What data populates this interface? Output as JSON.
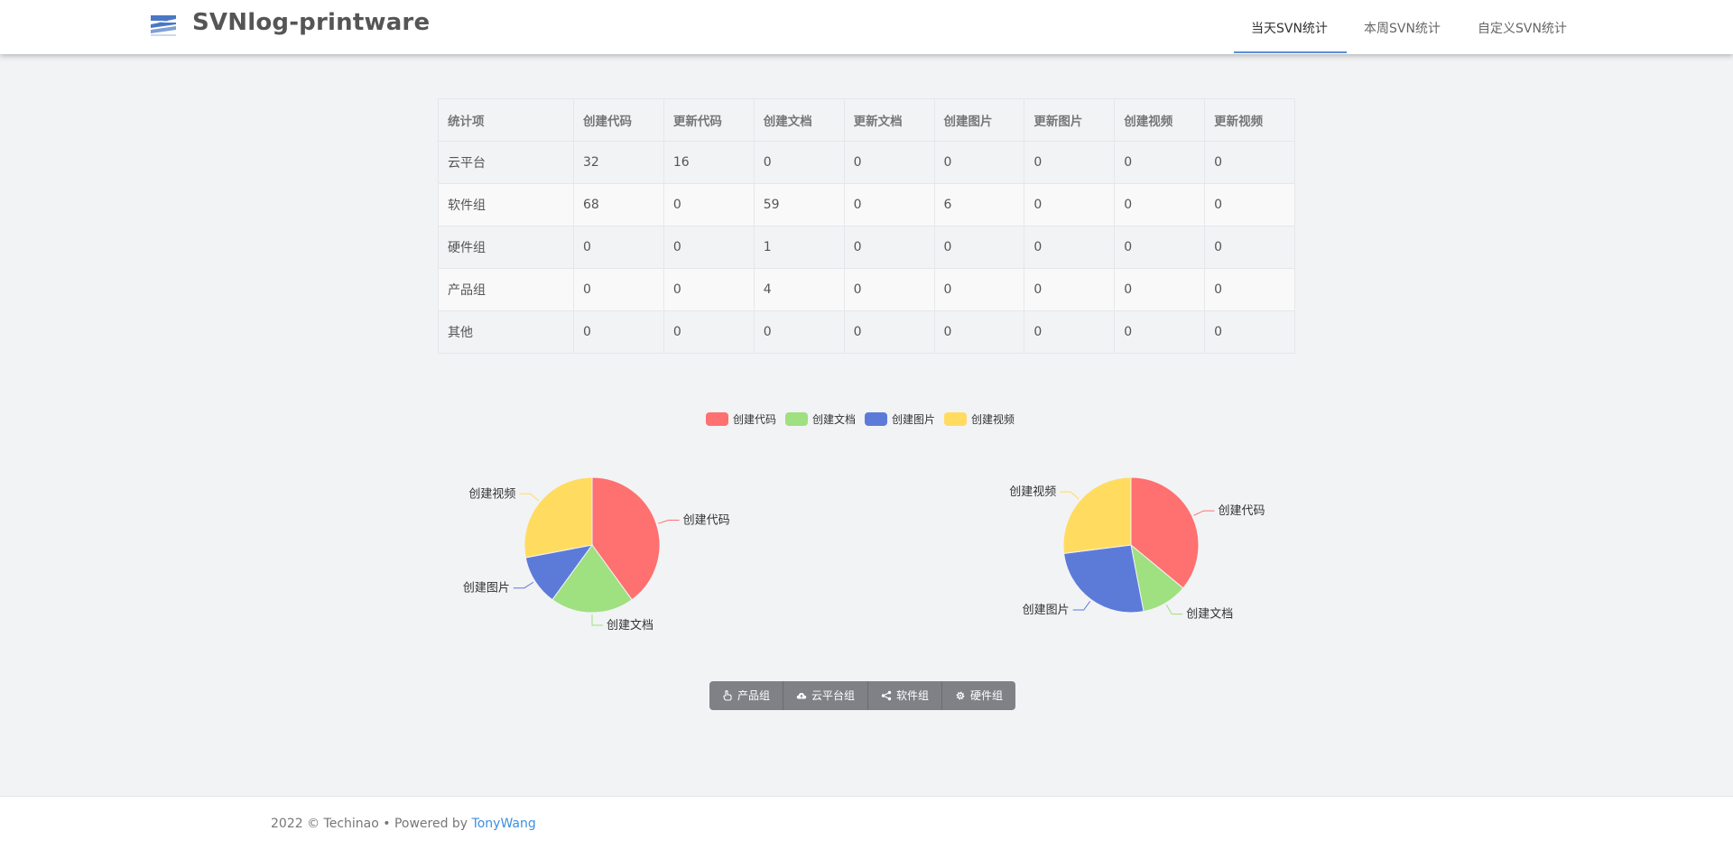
{
  "header": {
    "title": "SVNlog-printware",
    "nav": [
      {
        "label": "当天SVN统计",
        "active": true
      },
      {
        "label": "本周SVN统计",
        "active": false
      },
      {
        "label": "自定义SVN统计",
        "active": false
      }
    ]
  },
  "table": {
    "headers": [
      "统计项",
      "创建代码",
      "更新代码",
      "创建文档",
      "更新文档",
      "创建图片",
      "更新图片",
      "创建视频",
      "更新视频"
    ],
    "rows": [
      [
        "云平台",
        "32",
        "16",
        "0",
        "0",
        "0",
        "0",
        "0",
        "0"
      ],
      [
        "软件组",
        "68",
        "0",
        "59",
        "0",
        "6",
        "0",
        "0",
        "0"
      ],
      [
        "硬件组",
        "0",
        "0",
        "1",
        "0",
        "0",
        "0",
        "0",
        "0"
      ],
      [
        "产品组",
        "0",
        "0",
        "4",
        "0",
        "0",
        "0",
        "0",
        "0"
      ],
      [
        "其他",
        "0",
        "0",
        "0",
        "0",
        "0",
        "0",
        "0",
        "0"
      ]
    ]
  },
  "legend": [
    {
      "label": "创建代码",
      "color": "#ff7070"
    },
    {
      "label": "创建文档",
      "color": "#9fe080"
    },
    {
      "label": "创建图片",
      "color": "#5c7bd9"
    },
    {
      "label": "创建视频",
      "color": "#ffdc60"
    }
  ],
  "chart_data": [
    {
      "type": "pie",
      "categories": [
        "创建代码",
        "创建文档",
        "创建图片",
        "创建视频"
      ],
      "values": [
        40,
        20,
        12,
        28
      ],
      "colors": [
        "#ff7070",
        "#9fe080",
        "#5c7bd9",
        "#ffdc60"
      ]
    },
    {
      "type": "pie",
      "categories": [
        "创建代码",
        "创建文档",
        "创建图片",
        "创建视频"
      ],
      "values": [
        36,
        11,
        26,
        27
      ],
      "colors": [
        "#ff7070",
        "#9fe080",
        "#5c7bd9",
        "#ffdc60"
      ]
    }
  ],
  "buttons": [
    {
      "label": "产品组",
      "icon": "hand-pointer-icon"
    },
    {
      "label": "云平台组",
      "icon": "cloud-icon"
    },
    {
      "label": "软件组",
      "icon": "share-icon"
    },
    {
      "label": "硬件组",
      "icon": "gear-icon"
    }
  ],
  "footer": {
    "text": "2022 © Techinao • Powered by ",
    "link": "TonyWang"
  }
}
